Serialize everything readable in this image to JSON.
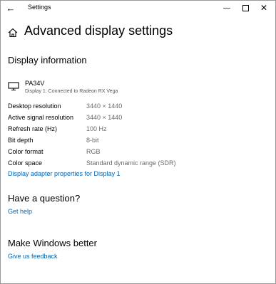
{
  "window": {
    "title": "Settings",
    "back_glyph": "←",
    "minimize_glyph": "—",
    "close_glyph": "✕"
  },
  "icons": {
    "back": "back-arrow-icon",
    "home": "home-icon",
    "monitor": "monitor-icon",
    "minimize": "minimize-icon",
    "maximize": "maximize-icon",
    "close": "close-icon"
  },
  "colors": {
    "link": "#0063b1",
    "secondary_text": "#6b6b6b"
  },
  "page": {
    "title": "Advanced display settings"
  },
  "display_info": {
    "heading": "Display information",
    "monitor_name": "PA34V",
    "monitor_subtitle": "Display 1: Connected to Radeon RX Vega",
    "rows": [
      {
        "label": "Desktop resolution",
        "value": "3440 × 1440"
      },
      {
        "label": "Active signal resolution",
        "value": "3440 × 1440"
      },
      {
        "label": "Refresh rate (Hz)",
        "value": "100 Hz"
      },
      {
        "label": "Bit depth",
        "value": "8-bit"
      },
      {
        "label": "Color format",
        "value": "RGB"
      },
      {
        "label": "Color space",
        "value": "Standard dynamic range (SDR)"
      }
    ],
    "adapter_link": "Display adapter properties for Display 1"
  },
  "question": {
    "heading": "Have a question?",
    "link": "Get help"
  },
  "feedback": {
    "heading": "Make Windows better",
    "link": "Give us feedback"
  }
}
